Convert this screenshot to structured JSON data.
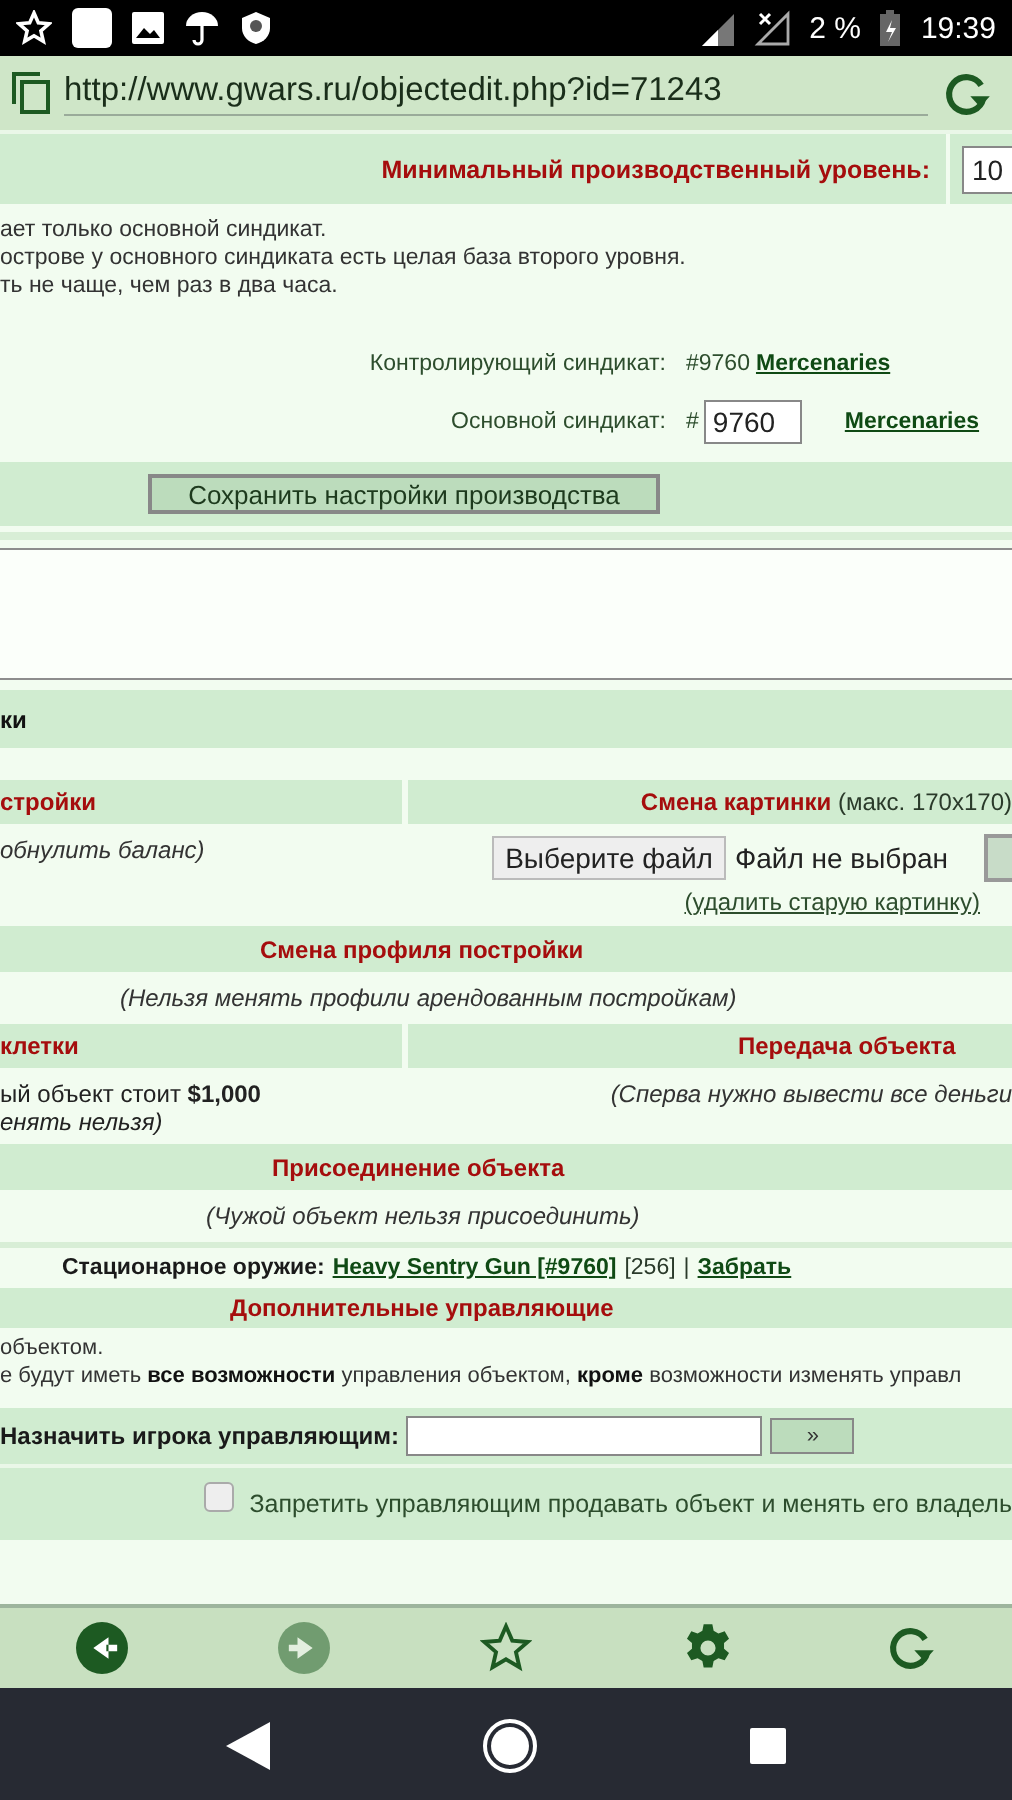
{
  "status_bar": {
    "battery": "2 %",
    "time": "19:39"
  },
  "address_bar": {
    "url": "http://www.gwars.ru/objectedit.php?id=71243"
  },
  "production": {
    "min_level_label": "Минимальный производственный уровень:",
    "min_level_value": "10",
    "notes": [
      "ает только основной синдикат.",
      "острове у основного синдиката есть целая база второго уровня.",
      "ть не чаще, чем раз в два часа."
    ],
    "controlling": {
      "label": "Контролирующий синдикат:",
      "number": "#9760",
      "link": "Mercenaries"
    },
    "main_syndicate": {
      "label": "Основной синдикат:",
      "prefix": "#",
      "value": "9760",
      "link": "Mercenaries"
    },
    "save_button": "Сохранить настройки производства"
  },
  "section_title": "ки",
  "balance": {
    "title": "стройки",
    "note": "обнулить баланс)"
  },
  "picture_change": {
    "title": "Смена картинки",
    "suffix": "(макс. 170x170)",
    "file_button": "Выберите файл",
    "file_status": "Файл не выбран",
    "delete_link": "(удалить старую картинку)"
  },
  "profile_change": {
    "title": "Смена профиля постройки",
    "note": "(Нельзя менять профили арендованным постройкам)"
  },
  "cell": {
    "title": "клетки",
    "notes": [
      "ый объект стоит **$1,000**",
      "енять нельзя)"
    ]
  },
  "transfer": {
    "title": "Передача объекта",
    "note": "(Сперва нужно вывести все деньги"
  },
  "join": {
    "title": "Присоединение объекта",
    "note": "(Чужой объект нельзя присоединить)"
  },
  "weapon": {
    "label": "Стационарное оружие:",
    "link": "Heavy Sentry Gun [#9760]",
    "count": "[256]",
    "separator": "|",
    "action": "Забрать"
  },
  "managers": {
    "title": "Дополнительные управляющие",
    "notes": [
      "объектом.",
      "е будут иметь **все возможности** управления объектом, **кроме** возможности изменять управл"
    ],
    "assign_label": "Назначить игрока управляющим:",
    "submit": "»",
    "restrict": {
      "label": "Запретить управляющим продавать объект и менять его владель",
      "checked": false
    }
  },
  "toolbar": [
    {
      "kind": "back",
      "disabled": false
    },
    {
      "kind": "forward",
      "disabled": true
    },
    {
      "kind": "bookmark",
      "disabled": false
    },
    {
      "kind": "settings",
      "disabled": false
    },
    {
      "kind": "reload",
      "disabled": false
    }
  ]
}
